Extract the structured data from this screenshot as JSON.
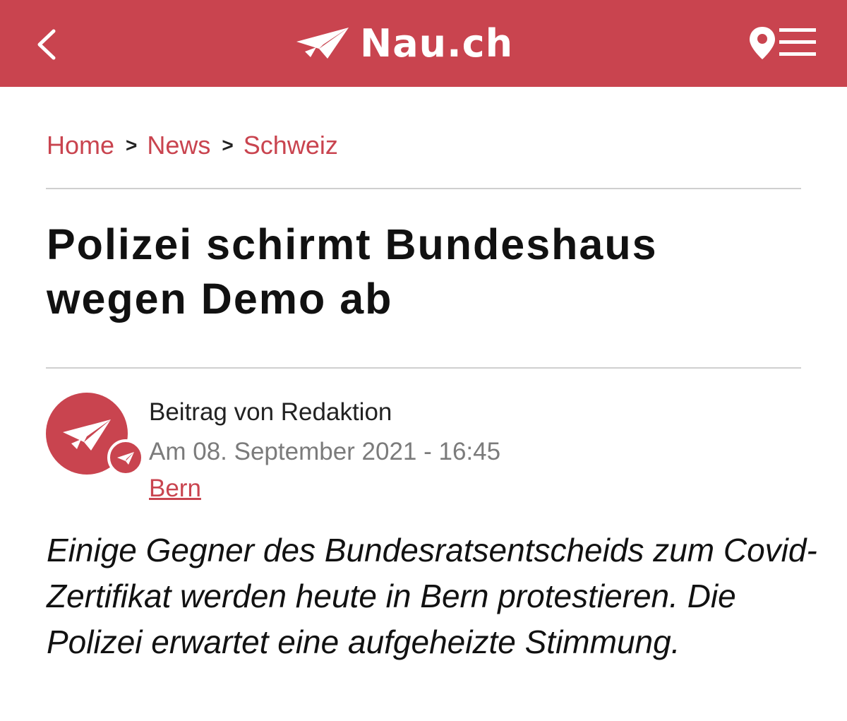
{
  "colors": {
    "brand": "#c9444f",
    "divider": "#cfcfcf",
    "meta_gray": "#7b7b7b"
  },
  "header": {
    "back_icon": "chevron-left-icon",
    "logo_icon": "paper-plane-icon",
    "logo_text": "Nau.ch",
    "location_icon": "map-pin-icon",
    "menu_icon": "hamburger-menu-icon"
  },
  "breadcrumb": {
    "items": [
      {
        "label": "Home"
      },
      {
        "label": "News"
      },
      {
        "label": "Schweiz"
      }
    ],
    "separator": ">"
  },
  "article": {
    "title": "Polizei schirmt Bundeshaus wegen Demo ab",
    "byline": "Beitrag von Redaktion",
    "date": "Am 08. September 2021 - 16:45",
    "location": "Bern",
    "lead": "Einige Gegner des Bundesratsentscheids zum Covid-Zertifikat werden heute in Bern protestieren. Die Polizei erwartet eine aufgeheizte Stimmung."
  }
}
